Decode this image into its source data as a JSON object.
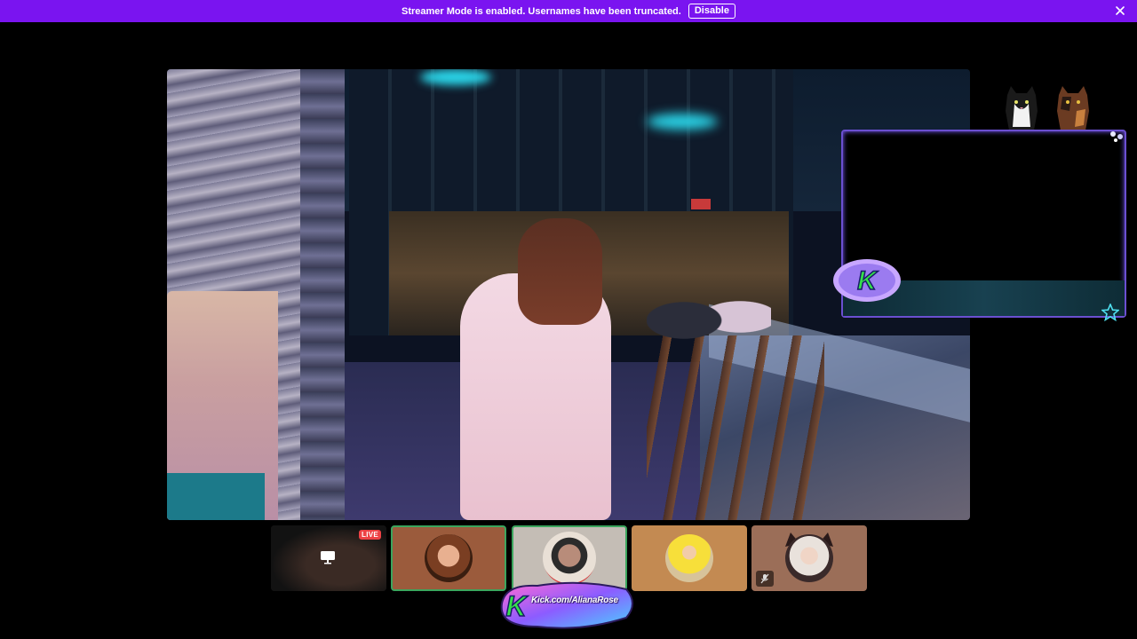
{
  "banner": {
    "message": "Streamer Mode is enabled. Usernames have been truncated.",
    "disable_label": "Disable",
    "close_icon": "close-icon",
    "color": "#7a14f0"
  },
  "stream": {
    "icon": "video-stream"
  },
  "overlay": {
    "logo_letter": "K",
    "border_color": "#6b4fd1"
  },
  "participants": {
    "tiles": [
      {
        "id": "screen-share",
        "live_label": "LIVE",
        "icon": "screen-share-icon"
      },
      {
        "id": "participant-2",
        "speaking": true
      },
      {
        "id": "participant-3",
        "speaking": true
      },
      {
        "id": "participant-4",
        "speaking": false
      },
      {
        "id": "participant-5",
        "muted": true,
        "icon": "mic-muted-icon"
      }
    ]
  },
  "kick_logo": {
    "letter": "K",
    "text": "Kick.com/AlianaRose"
  }
}
